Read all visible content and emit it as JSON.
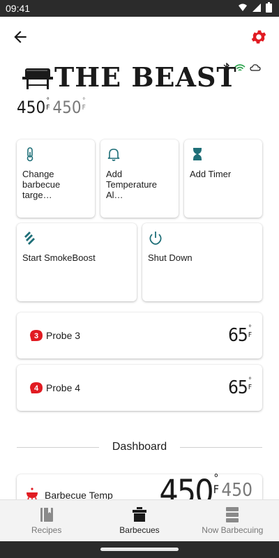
{
  "status_bar": {
    "time": "09:41"
  },
  "header": {
    "title": "THE BEAST",
    "current_temp": "450",
    "current_unit": "F",
    "target_temp": "450",
    "target_unit": "F"
  },
  "actions": [
    {
      "label": "Change barbecue targe…",
      "icon": "thermometer-icon"
    },
    {
      "label": "Add Temperature Al…",
      "icon": "bell-icon"
    },
    {
      "label": "Add Timer",
      "icon": "hourglass-icon"
    },
    {
      "label": "Start SmokeBoost",
      "icon": "smokeboost-icon"
    },
    {
      "label": "Shut Down",
      "icon": "power-icon"
    }
  ],
  "probes": [
    {
      "badge": "3",
      "name": "Probe 3",
      "value": "65",
      "unit": "F"
    },
    {
      "badge": "4",
      "name": "Probe 4",
      "value": "65",
      "unit": "F"
    }
  ],
  "dashboard": {
    "heading": "Dashboard",
    "bbq_temp_label": "Barbecue Temp",
    "bbq_current": "450",
    "bbq_unit": "F",
    "bbq_target": "450"
  },
  "nav": [
    {
      "label": "Recipes",
      "icon": "recipes-icon",
      "active": false
    },
    {
      "label": "Barbecues",
      "icon": "barbecue-icon",
      "active": true
    },
    {
      "label": "Now Barbecuing",
      "icon": "now-barbecuing-icon",
      "active": false
    }
  ],
  "colors": {
    "accent": "#e11b22",
    "teal": "#1f6f78",
    "text": "#1c1c1c",
    "muted": "#7a7a7a",
    "wifi": "#2ea44f"
  }
}
